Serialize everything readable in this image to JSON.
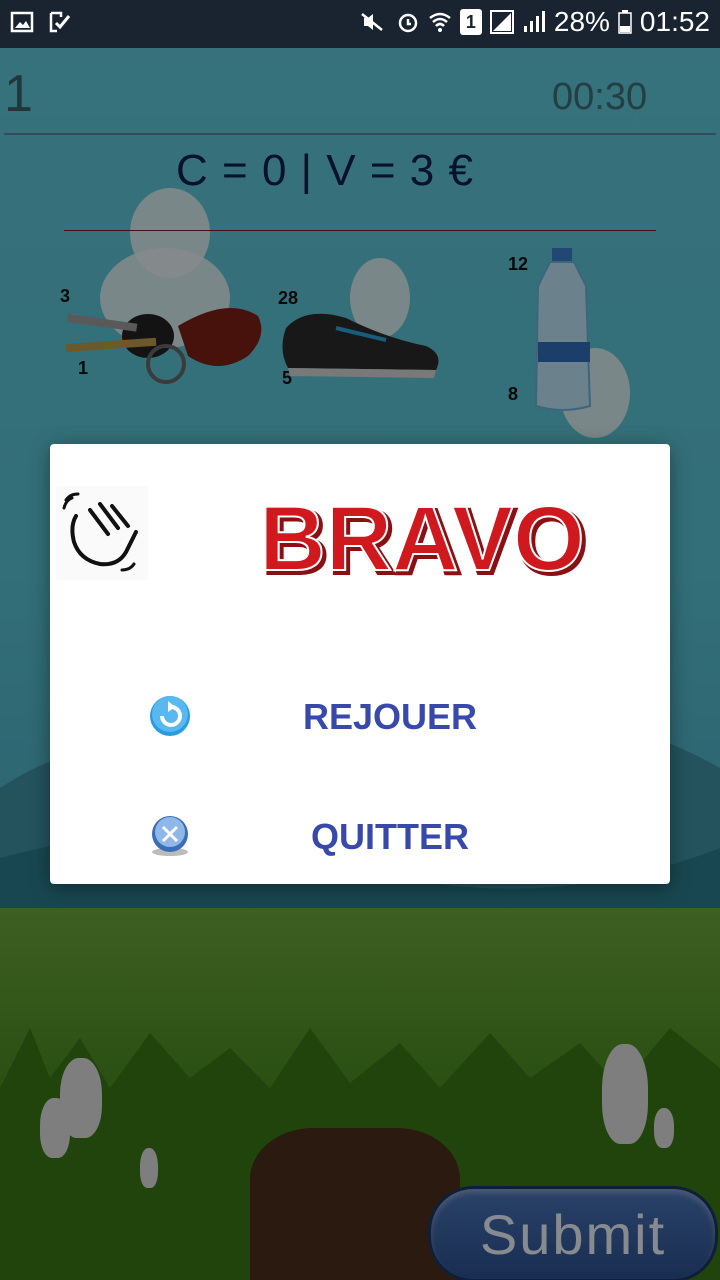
{
  "status_bar": {
    "battery": "28%",
    "time": "01:52",
    "sim": "1",
    "icons": [
      "image-icon",
      "checkmark-icon",
      "mute-icon",
      "alarm-icon",
      "wifi-icon",
      "sim-icon",
      "signal-icon",
      "signal-icon",
      "battery-icon"
    ]
  },
  "game": {
    "level": "1",
    "timer": "00:30",
    "score": "C = 0  |  V = 3 €",
    "items": [
      {
        "name": "keys",
        "numbers": [
          "3",
          "1"
        ]
      },
      {
        "name": "shoe",
        "numbers": [
          "28",
          "5"
        ]
      },
      {
        "name": "bottle",
        "numbers": [
          "12",
          "8"
        ]
      }
    ],
    "submit_label": "Submit"
  },
  "dialog": {
    "title": "BRAVO",
    "replay_label": "REJOUER",
    "quit_label": "QUITTER"
  },
  "colors": {
    "accent": "#3949ab",
    "bravo_red": "#d0191f",
    "score_text": "#0e1f4a"
  }
}
